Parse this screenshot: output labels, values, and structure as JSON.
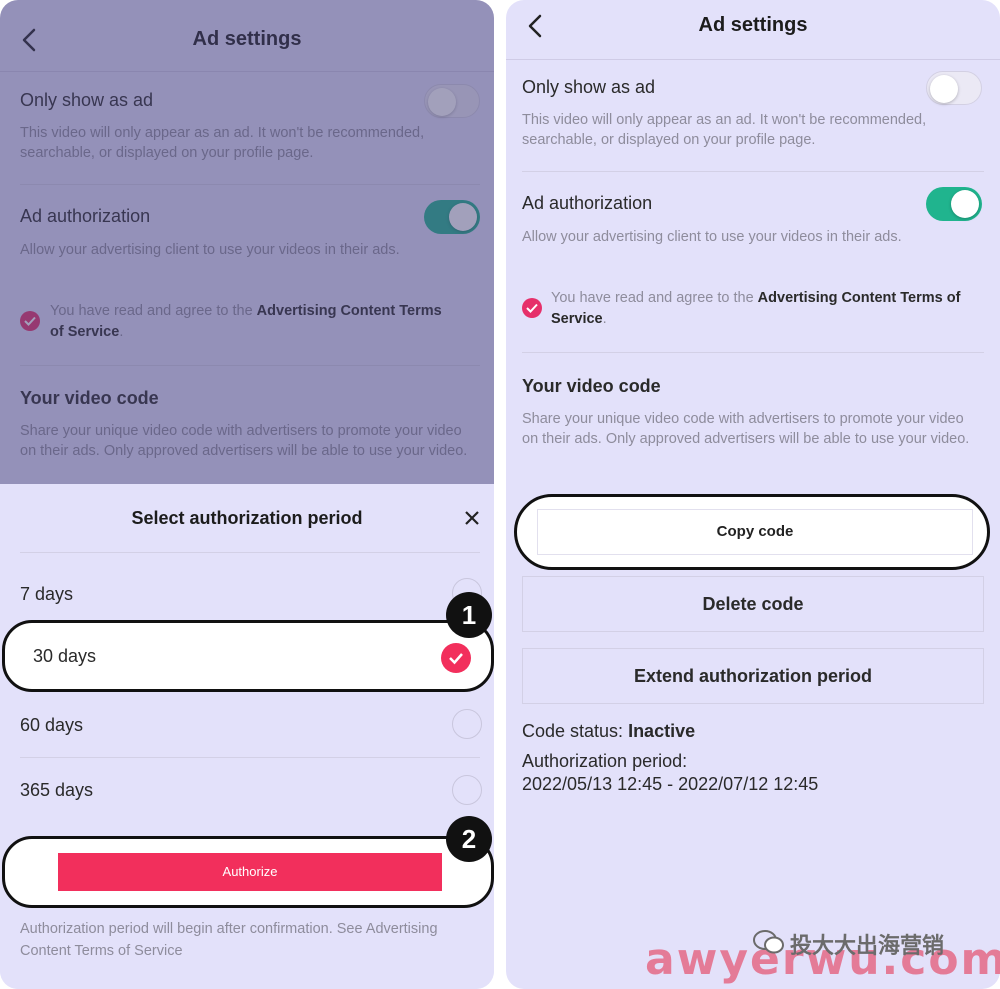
{
  "left": {
    "nav_title": "Ad settings",
    "only_ad": {
      "title": "Only show as ad",
      "description": "This video will only appear as an ad. It won't be recommended, searchable, or displayed on your profile page."
    },
    "ad_auth": {
      "title": "Ad authorization",
      "description": "Allow your advertising client to use your videos in their ads."
    },
    "terms": {
      "prefix": "You have read and agree to the ",
      "link": "Advertising Content Terms of Service",
      "suffix": "."
    },
    "video_code": {
      "title": "Your video code",
      "description": "Share your unique video code with advertisers to promote your video on their ads. Only approved advertisers will be able to use your video."
    },
    "sheet": {
      "title": "Select authorization period",
      "options": [
        "7 days",
        "30 days",
        "60 days",
        "365 days"
      ],
      "selected_index": 1,
      "authorize_label": "Authorize",
      "footnote": "Authorization period will begin after confirmation. See Advertising Content Terms of Service",
      "step1": "1",
      "step2": "2"
    }
  },
  "right": {
    "nav_title": "Ad settings",
    "only_ad": {
      "title": "Only show as ad",
      "description": "This video will only appear as an ad. It won't be recommended, searchable, or displayed on your profile page."
    },
    "ad_auth": {
      "title": "Ad authorization",
      "description": "Allow your advertising client to use your videos in their ads."
    },
    "terms": {
      "prefix": "You have read and agree to the ",
      "link": "Advertising Content Terms of Service",
      "suffix": "."
    },
    "video_code": {
      "title": "Your video code",
      "description": "Share your unique video code with advertisers to promote your video on their ads. Only approved advertisers will be able to use your video."
    },
    "copy_code_label": "Copy code",
    "delete_code_label": "Delete code",
    "extend_label": "Extend authorization period",
    "status_label": "Code status: ",
    "status_value": "Inactive",
    "period_label": "Authorization period:",
    "period_value": "2022/05/13 12:45 - 2022/07/12 12:45"
  },
  "watermark": {
    "cn": "投大大出海营销",
    "domain": "awyerwu.com"
  },
  "colors": {
    "panel_bg": "#e3e1fa",
    "toggle_on": "#20b48e",
    "accent_pink": "#f22f5c",
    "check_pink": "#e6306a"
  },
  "toggles": {
    "only_ad_on": false,
    "ad_auth_on": true
  }
}
